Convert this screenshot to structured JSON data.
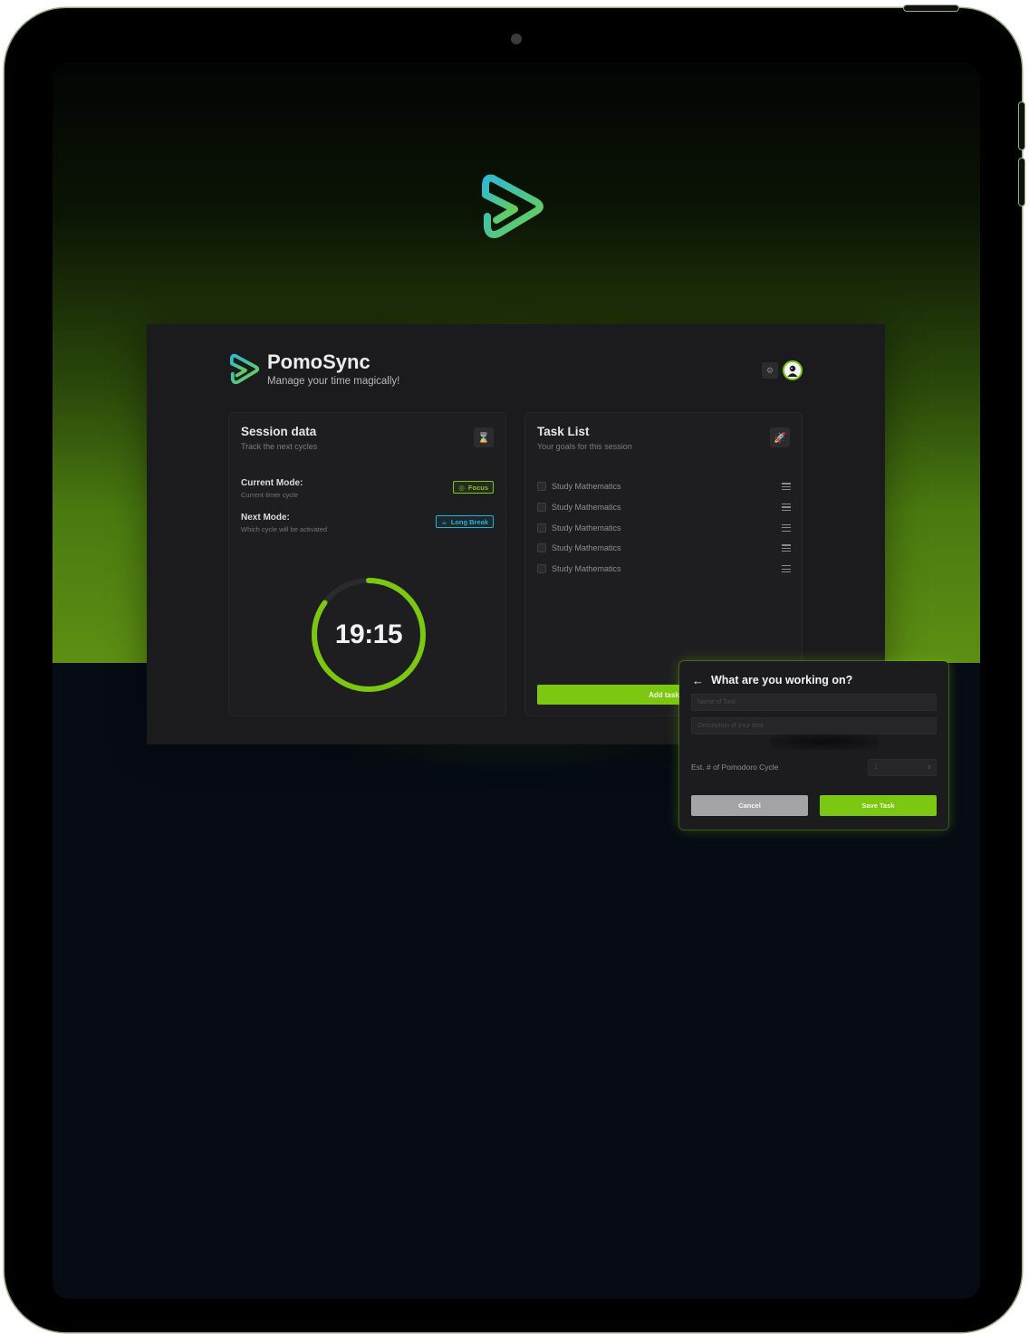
{
  "app": {
    "title": "PomoSync",
    "tagline": "Manage your time magically!"
  },
  "session": {
    "title": "Session data",
    "subtitle": "Track the next cycles",
    "current_mode_label": "Current Mode:",
    "current_mode_hint": "Current timer cycle",
    "current_mode_value": "Focus",
    "next_mode_label": "Next Mode:",
    "next_mode_hint": "Which cycle will be activated",
    "next_mode_value": "Long Break",
    "timer": "19:15",
    "timer_progress": 0.85
  },
  "tasks": {
    "title": "Task List",
    "subtitle": "Your goals for this session",
    "items": [
      {
        "name": "Study Mathematics"
      },
      {
        "name": "Study Mathematics"
      },
      {
        "name": "Study Mathematics"
      },
      {
        "name": "Study Mathematics"
      },
      {
        "name": "Study Mathematics"
      }
    ],
    "add_label": "Add task"
  },
  "dialog": {
    "title": "What are you working on?",
    "name_placeholder": "Name of Task",
    "desc_placeholder": "Description of your task",
    "est_label": "Est. # of Pomodoro Cycle",
    "est_value": "1",
    "cancel_label": "Cancel",
    "save_label": "Save Task"
  },
  "colors": {
    "accent": "#7cc712",
    "break": "#1fb4d6",
    "logo_start": "#2fb8d6",
    "logo_end": "#6ed14a"
  }
}
